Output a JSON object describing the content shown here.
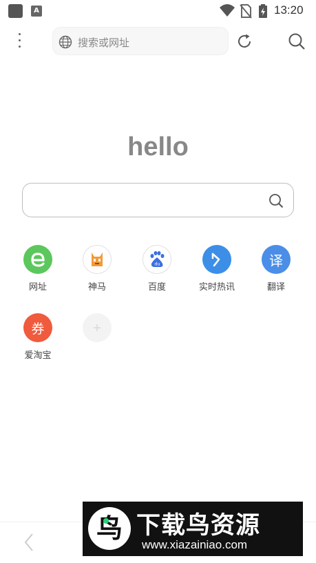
{
  "status_bar": {
    "time": "13:20",
    "app_badge": "A",
    "icons": [
      "app-icon",
      "accessibility-icon",
      "wifi-icon",
      "no-sim-icon",
      "battery-charging-icon"
    ]
  },
  "toolbar": {
    "url_placeholder": "搜索或网址",
    "icons": [
      "menu-icon",
      "globe-icon",
      "refresh-icon",
      "search-icon"
    ]
  },
  "home": {
    "title": "hello",
    "search_value": ""
  },
  "shortcuts": [
    {
      "label": "网址",
      "icon": "e",
      "color": "#5cc75c"
    },
    {
      "label": "神马",
      "icon": "shenma-icon",
      "color": "#f29b38"
    },
    {
      "label": "百度",
      "icon": "baidu-icon",
      "color": "#3d6fe0"
    },
    {
      "label": "实时热讯",
      "icon": "arrow-icon",
      "color": "#3d8ee6"
    },
    {
      "label": "翻译",
      "icon": "译",
      "color": "#4a8ee8"
    },
    {
      "label": "爱淘宝",
      "icon": "券",
      "color": "#f05a3d"
    },
    {
      "label": "",
      "icon": "add-icon",
      "color": "#f3f3f3"
    }
  ],
  "bottom_nav": {
    "icons": [
      "back-icon"
    ]
  },
  "watermark": {
    "title": "下载鸟资源",
    "url": "www.xiazainiao.com",
    "badge": "鸟"
  }
}
